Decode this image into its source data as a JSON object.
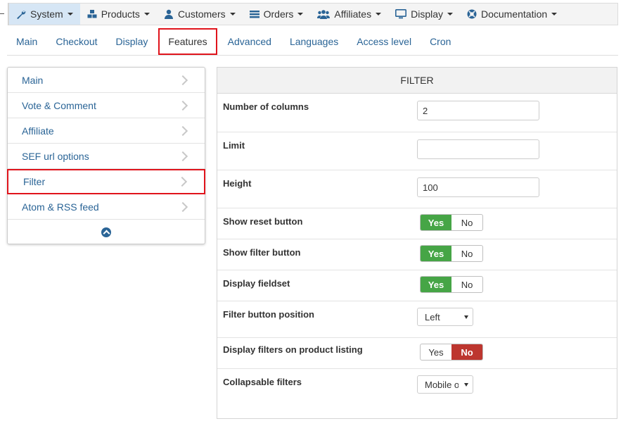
{
  "topmenu": {
    "items": [
      {
        "label": "System",
        "icon": "wrench-icon"
      },
      {
        "label": "Products",
        "icon": "cubes-icon"
      },
      {
        "label": "Customers",
        "icon": "user-icon"
      },
      {
        "label": "Orders",
        "icon": "list-icon"
      },
      {
        "label": "Affiliates",
        "icon": "users-icon"
      },
      {
        "label": "Display",
        "icon": "monitor-icon"
      },
      {
        "label": "Documentation",
        "icon": "lifebuoy-icon"
      }
    ]
  },
  "tabs": [
    "Main",
    "Checkout",
    "Display",
    "Features",
    "Advanced",
    "Languages",
    "Access level",
    "Cron"
  ],
  "sidebar": {
    "items": [
      "Main",
      "Vote & Comment",
      "Affiliate",
      "SEF url options",
      "Filter",
      "Atom & RSS feed"
    ]
  },
  "panel": {
    "title": "FILTER",
    "rows": {
      "columns": {
        "label": "Number of columns",
        "value": "2"
      },
      "limit": {
        "label": "Limit",
        "value": ""
      },
      "height": {
        "label": "Height",
        "value": "100"
      },
      "reset": {
        "label": "Show reset button",
        "yes": "Yes",
        "no": "No"
      },
      "filterbtn": {
        "label": "Show filter button",
        "yes": "Yes",
        "no": "No"
      },
      "fieldset": {
        "label": "Display fieldset",
        "yes": "Yes",
        "no": "No"
      },
      "position": {
        "label": "Filter button position",
        "value": "Left"
      },
      "listing": {
        "label": "Display filters on product listing",
        "yes": "Yes",
        "no": "No"
      },
      "collapsable": {
        "label": "Collapsable filters",
        "value": "Mobile only"
      }
    }
  },
  "colors": {
    "accent_link": "#2a6496",
    "yes_green": "#46a546",
    "no_red": "#bd362f",
    "highlight_red": "#e0141c"
  }
}
